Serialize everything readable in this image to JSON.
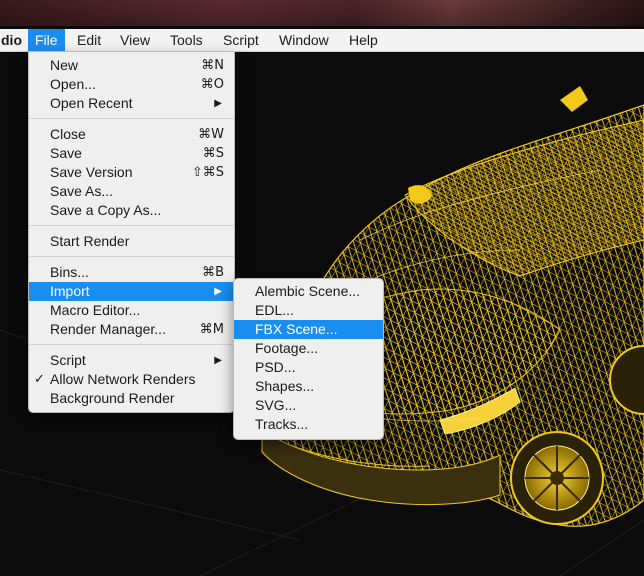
{
  "menubar": {
    "app_name": "dio",
    "items": [
      "File",
      "Edit",
      "View",
      "Tools",
      "Script",
      "Window",
      "Help"
    ]
  },
  "file_menu": {
    "items": [
      {
        "label": "New",
        "shortcut": "⌘N"
      },
      {
        "label": "Open...",
        "shortcut": "⌘O"
      },
      {
        "label": "Open Recent",
        "submenu": "▶"
      },
      {
        "label": "Close",
        "shortcut": "⌘W"
      },
      {
        "label": "Save",
        "shortcut": "⌘S"
      },
      {
        "label": "Save Version",
        "shortcut": "⇧⌘S"
      },
      {
        "label": "Save As..."
      },
      {
        "label": "Save a Copy As..."
      },
      {
        "label": "Start Render"
      },
      {
        "label": "Bins...",
        "shortcut": "⌘B"
      },
      {
        "label": "Import",
        "submenu": "▶"
      },
      {
        "label": "Macro Editor..."
      },
      {
        "label": "Render Manager...",
        "shortcut": "⌘M"
      },
      {
        "label": "Script",
        "submenu": "▶"
      },
      {
        "label": "Allow Network Renders",
        "check": "✓"
      },
      {
        "label": "Background Render"
      }
    ]
  },
  "import_menu": {
    "items": [
      "Alembic Scene...",
      "EDL...",
      "FBX Scene...",
      "Footage...",
      "PSD...",
      "Shapes...",
      "SVG...",
      "Tracks..."
    ]
  },
  "colors": {
    "highlight": "#1a8ef0",
    "menu_bg": "#efefef",
    "wireframe": "#f0c419",
    "viewport_bg": "#0b0b0b"
  },
  "icons": {
    "submenu": "chevron-right-icon",
    "check": "checkmark-icon"
  }
}
